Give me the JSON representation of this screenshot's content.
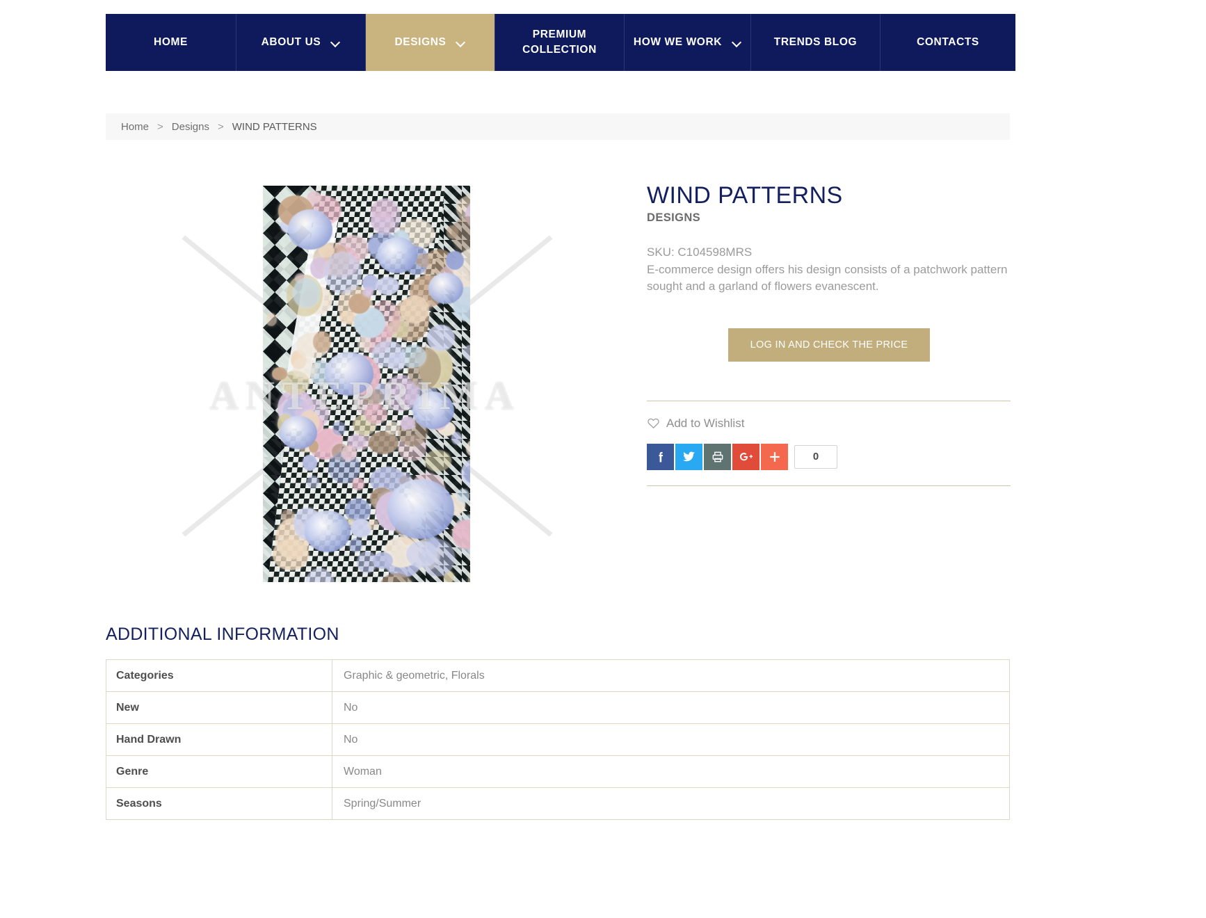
{
  "nav": {
    "items": [
      {
        "label": "HOME",
        "caret": false,
        "active": false,
        "width_class": "nav-w-home",
        "name": "nav-item-home"
      },
      {
        "label": "ABOUT US",
        "caret": true,
        "active": false,
        "width_class": "nav-w-about",
        "name": "nav-item-about-us"
      },
      {
        "label": "DESIGNS",
        "caret": true,
        "active": true,
        "width_class": "nav-w-designs",
        "name": "nav-item-designs"
      },
      {
        "label": "PREMIUM COLLECTION",
        "caret": false,
        "active": false,
        "width_class": "nav-w-premium",
        "name": "nav-item-premium-collection"
      },
      {
        "label": "HOW WE WORK",
        "caret": true,
        "active": false,
        "width_class": "nav-w-how",
        "name": "nav-item-how-we-work"
      },
      {
        "label": "TRENDS BLOG",
        "caret": false,
        "active": false,
        "width_class": "nav-w-trends",
        "name": "nav-item-trends-blog"
      },
      {
        "label": "CONTACTS",
        "caret": false,
        "active": false,
        "width_class": "nav-w-contacts",
        "name": "nav-item-contacts"
      }
    ]
  },
  "breadcrumb": {
    "home": "Home",
    "sep1": ">",
    "designs": "Designs",
    "sep2": ">",
    "current": "WIND PATTERNS"
  },
  "gallery": {
    "watermark": "ANTEPRIMA",
    "image_alt": "WIND PATTERNS textile design preview"
  },
  "product": {
    "title": "WIND PATTERNS",
    "subtitle": "DESIGNS",
    "sku": "SKU: C104598MRS",
    "description": "E-commerce design offers his design consists of a patchwork pattern sought and a garland of flowers evanescent.",
    "price_button": "LOG IN AND CHECK THE PRICE",
    "wishlist": "Add to Wishlist"
  },
  "share": {
    "count": "0",
    "buttons": [
      {
        "name": "share-facebook-button",
        "icon": "facebook-icon",
        "color": "#3b5998",
        "title": "Facebook"
      },
      {
        "name": "share-twitter-button",
        "icon": "twitter-icon",
        "color": "#29a9f1",
        "title": "Twitter"
      },
      {
        "name": "share-print-button",
        "icon": "printer-icon",
        "color": "#5f7370",
        "title": "Print"
      },
      {
        "name": "share-googleplus-button",
        "icon": "google-plus-icon",
        "color": "#e04b3a",
        "title": "Google+"
      },
      {
        "name": "share-more-button",
        "icon": "plus-icon",
        "color": "#f4694e",
        "title": "Share"
      }
    ]
  },
  "additional_information": {
    "title": "ADDITIONAL INFORMATION",
    "rows": [
      {
        "key": "Categories",
        "value": "Graphic & geometric, Florals"
      },
      {
        "key": "New",
        "value": "No"
      },
      {
        "key": "Hand Drawn",
        "value": "No"
      },
      {
        "key": "Genre",
        "value": "Woman"
      },
      {
        "key": "Seasons",
        "value": "Spring/Summer"
      }
    ]
  },
  "colors": {
    "navy": "#0e1a5c",
    "gold": "#c9b37e",
    "button_gold": "#c2ae7c",
    "title_navy": "#14205e",
    "muted_text": "#9b9b9b"
  }
}
